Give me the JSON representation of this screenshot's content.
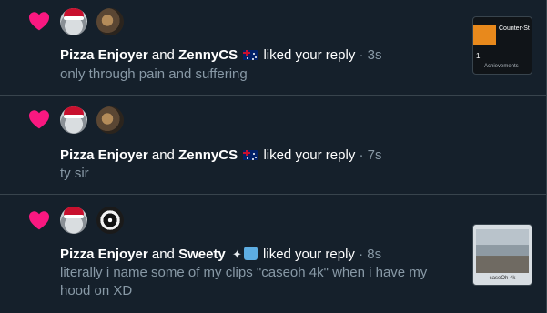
{
  "colors": {
    "background": "#15202b",
    "heart": "#f91880",
    "meta_text": "#8899a6",
    "divider": "#38444d"
  },
  "notifications": [
    {
      "icon": "heart-icon",
      "actor1": "Pizza Enjoyer",
      "conj": "and",
      "actor2": "ZennyCS",
      "actor2_badge": "australia-flag-icon",
      "action": "liked your reply",
      "sep": "·",
      "time": "3s",
      "text": "only through pain and suffering",
      "thumbnail": {
        "title": "Counter-St",
        "number": "1",
        "subtitle": "Achievements"
      }
    },
    {
      "icon": "heart-icon",
      "actor1": "Pizza Enjoyer",
      "conj": "and",
      "actor2": "ZennyCS",
      "actor2_badge": "australia-flag-icon",
      "action": "liked your reply",
      "sep": "·",
      "time": "7s",
      "text": "ty sir"
    },
    {
      "icon": "heart-icon",
      "actor1": "Pizza Enjoyer",
      "conj": "and",
      "actor2": "Sweety",
      "actor2_badge": "sparkle-icon",
      "action": "liked your reply",
      "sep": "·",
      "time": "8s",
      "text_line1": "literally i name some of my clips \"caseoh 4k\" when i have my",
      "text_line2": "hood on XD",
      "thumbnail": {
        "caption": "caseOh 4k"
      }
    }
  ]
}
